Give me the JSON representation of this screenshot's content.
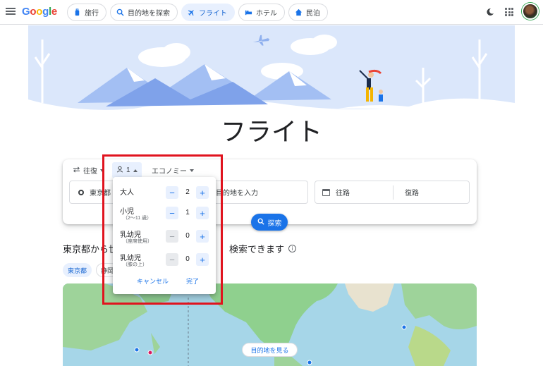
{
  "header": {
    "logo": {
      "G": "G",
      "o1": "o",
      "o2": "o",
      "g": "g",
      "l": "l",
      "e": "e"
    },
    "nav": [
      {
        "label": "旅行",
        "icon": "luggage-icon"
      },
      {
        "label": "目的地を探索",
        "icon": "explore-icon"
      },
      {
        "label": "フライト",
        "icon": "airplane-icon",
        "active": true
      },
      {
        "label": "ホテル",
        "icon": "bed-icon"
      },
      {
        "label": "民泊",
        "icon": "home-icon"
      }
    ]
  },
  "hero": {
    "title": "フライト"
  },
  "search": {
    "trip_type": "往復",
    "passengers": "1",
    "cabin_class": "エコノミー",
    "origin": "東京都",
    "destination_placeholder": "目的地を入力",
    "depart_placeholder": "往路",
    "return_placeholder": "復路",
    "search_label": "探索"
  },
  "passenger_dropdown": {
    "rows": [
      {
        "label": "大人",
        "sub": "",
        "value": "2",
        "minus_disabled": false
      },
      {
        "label": "小児",
        "sub": "（2〜11 歳）",
        "value": "1",
        "minus_disabled": false
      },
      {
        "label": "乳幼児",
        "sub": "（座席使用）",
        "value": "0",
        "minus_disabled": true
      },
      {
        "label": "乳幼児",
        "sub": "（膝の上）",
        "value": "0",
        "minus_disabled": true
      }
    ],
    "cancel_label": "キャンセル",
    "done_label": "完了"
  },
  "explore": {
    "title_left": "東京都から世",
    "title_right": "検索できます",
    "chips": [
      "東京都",
      "静岡"
    ],
    "map_button": "目的地を見る"
  },
  "colors": {
    "accent": "#1a73e8",
    "highlight": "#e0131e"
  }
}
